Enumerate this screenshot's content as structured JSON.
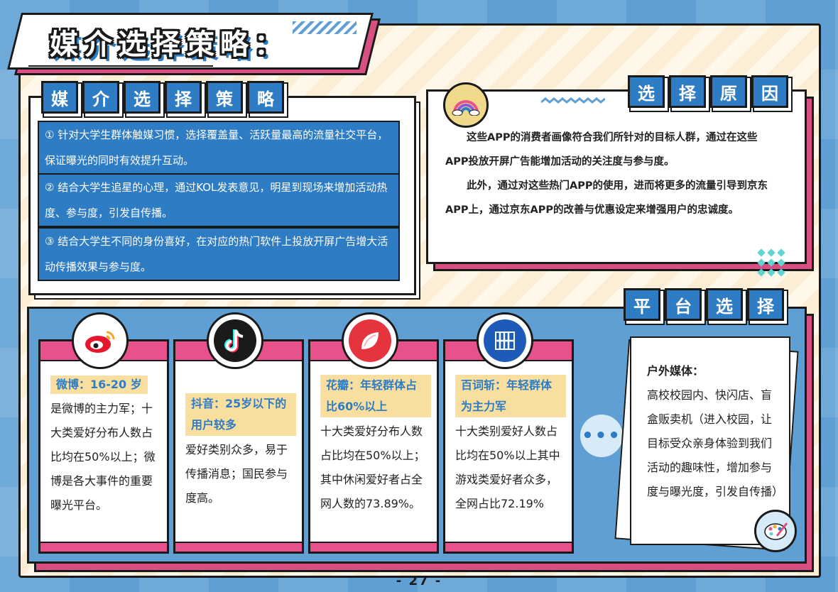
{
  "title": "媒介选择策略：",
  "strategy": {
    "heading_chars": [
      "媒",
      "介",
      "选",
      "择",
      "策",
      "略"
    ],
    "items": [
      "① 针对大学生群体触媒习惯，选择覆盖量、活跃量最高的流量社交平台，保证曝光的同时有效提升互动。",
      "② 结合大学生追星的心理，通过KOL发表意见，明星到现场来增加活动热度、参与度，引发自传播。",
      "③ 结合大学生不同的身份喜好，在对应的热门软件上投放开屏广告增大活动传播效果与参与度。"
    ]
  },
  "reason": {
    "heading_chars": [
      "选",
      "择",
      "原",
      "因"
    ],
    "paragraphs": [
      "这些APP的消费者画像符合我们所针对的目标人群，通过在这些APP投放开屏广告能增加活动的关注度与参与度。",
      "此外，通过对这些热门APP的使用，进而将更多的流量引导到京东APP上，通过京东APP的改善与优惠设定来增强用户的忠诚度。"
    ]
  },
  "platform": {
    "heading_chars": [
      "平",
      "台",
      "选",
      "择"
    ],
    "cards": [
      {
        "icon": "weibo-icon",
        "tag": "微博：16-20 岁",
        "body": "是微博的主力军；十大类爱好分布人数占比均在50%以上；微博是各大事件的重要曝光平台。"
      },
      {
        "icon": "douyin-icon",
        "tag": "抖音：25岁以下的用户较多",
        "body": "爱好类别众多，易于传播消息；国民参与度高。"
      },
      {
        "icon": "huaban-icon",
        "tag": "花瓣：年轻群体占比60%以上",
        "body": "十大类爱好分布人数占比均在50%以上；其中休闲爱好者占全网人数的73.89%。"
      },
      {
        "icon": "baicizhan-icon",
        "tag": "百词斩：年轻群体为主力军",
        "body": "十大类别爱好人数占比均在50%以上其中游戏类爱好者众多，全网占比72.19%"
      }
    ],
    "more": "•••",
    "outdoor": {
      "title": "户外媒体：",
      "body": "高校校园内、快闪店、盲盒贩卖机（进入校园，让目标受众亲身体验到我们活动的趣味性，增加参与度与曝光度，引发自传播）"
    }
  },
  "colors": {
    "blue": "#2e7cc4",
    "pink": "#e8528c",
    "cream": "#fbeed4",
    "tag": "#f8dfa0"
  },
  "page_number": "- 27 -"
}
